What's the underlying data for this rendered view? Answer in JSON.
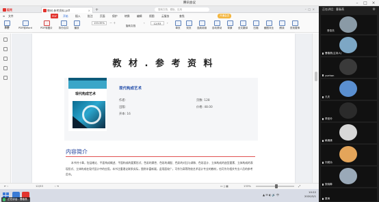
{
  "meeting": {
    "title": "腾讯会议"
  },
  "wps": {
    "app_tab": "稻壳",
    "doc_tab": "教材.参考资料.pdf",
    "search_hint": "搜索文档、模板、应用",
    "menu": [
      "文件",
      "开始",
      "插入",
      "批注",
      "页面",
      "保护",
      "转换",
      "编辑",
      "视图",
      "云服务"
    ],
    "pdf_label": "PDF",
    "menu_extra": [
      "查找",
      "开通会员"
    ],
    "toolbar": {
      "hand_label": "手型",
      "select_label": "选择",
      "to_word_label": "PDF转Word",
      "pdf_to_image_label": "PDF转图片",
      "split_merge_label": "拆分合并",
      "play_label": "播放",
      "rotate_label": "旋转文档",
      "zoom_value": "133.35%",
      "page_value": "12/53",
      "single_label": "单页",
      "double_label": "双页",
      "continuous_label": "连续阅读",
      "auto_scroll_label": "自动滚动",
      "background_label": "背景",
      "full_translate_label": "全文翻译",
      "compress_label": "压缩",
      "screenshot_label": "截图对比",
      "read_aloud_label": "朗读",
      "find_label": "查找替换"
    }
  },
  "page": {
    "heading": "教 材 . 参 考 资 料",
    "book": {
      "title": "现代构成艺术",
      "cover_title": "现代构成艺术",
      "author_label": "作者:",
      "pages_label": "页数: 128",
      "publisher_label": "出版:",
      "price_label": "价格: 48.00",
      "format_label": "开本: 16"
    },
    "section_title": "内容简介",
    "paragraph": "本书共十章，包括绪论、平面构成概述、平面构成的要素形式、色彩的属性、色彩的调配、色彩的对比与调和、色彩设计、立体构成的造型要素、立体构成的表现形式、立体构成在现代设计中的应用。本书注重理论联系实际，图例丰富新颖，适用面较广，可作为高等院校艺术设计专业的教材，也可作为相关专业人员的参考用书。"
  },
  "status": {
    "page_indicator": "12/53",
    "zoom_percent": "133%"
  },
  "taskbar": {
    "time": "10:22",
    "date": "2020/3/1"
  },
  "speaking": "正在讲话：曹春燕",
  "panel": {
    "header": "正在讲话：曹春燕",
    "participants": [
      {
        "name": "曹春燕"
      },
      {
        "name": "曹春燕(主持人)"
      },
      {
        "name": "yuehan"
      },
      {
        "name": "凡夫"
      },
      {
        "name": "李亚玲"
      },
      {
        "name": "韩清清"
      },
      {
        "name": "刘成功"
      },
      {
        "name": "张晓琳"
      },
      {
        "name": "夏雨"
      }
    ]
  }
}
